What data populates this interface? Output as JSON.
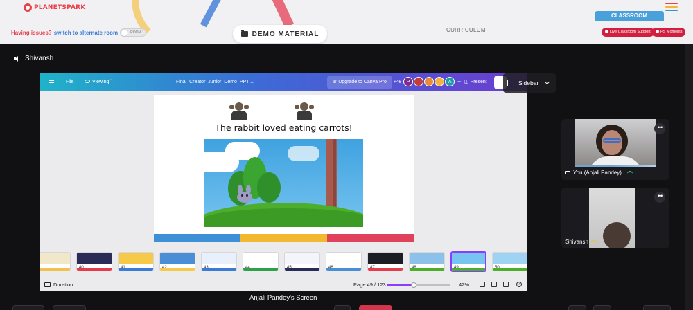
{
  "app": {
    "logo_text": "PLANETSPARK",
    "issues_text": "Having issues?",
    "switch_link": "switch to alternate room",
    "room_toggle_label": "ROOM 1",
    "demo_material_label": "DEMO MATERIAL",
    "curriculum_label": "CURRICULUM",
    "classroom_tab": "CLASSROOM",
    "live_support_label": "Live Classroom Support",
    "ps_moments_label": "PS Moments"
  },
  "meeting": {
    "presenter_name": "Shivansh",
    "screen_label": "Anjali Pandey's Screen",
    "sidebar_label": "Sidebar",
    "participants": [
      {
        "name": "You (Anjali Pandey)",
        "connection_color": "#2ecc71"
      },
      {
        "name": "Shivansh",
        "connection_color": "#f1c40f"
      }
    ]
  },
  "canva": {
    "file_label": "File",
    "viewing_label": "Viewing",
    "doc_title": "Final_Creator_Junior_Demo_PPT ...",
    "upgrade_label": "Upgrade to Canva Pro",
    "collab_count": "+46",
    "collaborators": [
      {
        "initial": "P",
        "color": "#7b2d8e"
      },
      {
        "initial": "",
        "color": "#c43b3b"
      },
      {
        "initial": "",
        "color": "#e88c3a"
      },
      {
        "initial": "",
        "color": "#f3b340"
      },
      {
        "initial": "A",
        "color": "#1f9aa8"
      }
    ],
    "add_label": "+",
    "present_label": "Present",
    "slide_text": "The rabbit loved eating carrots!",
    "thumbnails": [
      {
        "num": "",
        "band": "#f1e7c9",
        "bar": "#f2c14e"
      },
      {
        "num": "40",
        "band": "#2b2b58",
        "bar": "#e43c4c"
      },
      {
        "num": "41",
        "band": "#f7c948",
        "bar": "#3a7bd5"
      },
      {
        "num": "42",
        "band": "#4a8fd6",
        "bar": "#f7c948"
      },
      {
        "num": "43",
        "band": "#e8f0fb",
        "bar": "#3a7bd5"
      },
      {
        "num": "44",
        "band": "#ffffff",
        "bar": "#2ea04a"
      },
      {
        "num": "45",
        "band": "#f3f5fa",
        "bar": "#2b2b58"
      },
      {
        "num": "46",
        "band": "#ffffff",
        "bar": "#4a8fd6"
      },
      {
        "num": "47",
        "band": "#1d1d24",
        "bar": "#e43c4c"
      },
      {
        "num": "48",
        "band": "#8cc2ea",
        "bar": "#4cae2a"
      },
      {
        "num": "49",
        "band": "#76c4ef",
        "bar": "#4cae2a"
      },
      {
        "num": "50",
        "band": "#9fd3f3",
        "bar": "#4cae2a"
      }
    ],
    "thumb_slot": {
      "active_index": 10
    },
    "duration_label": "Duration",
    "page_indicator": "Page 49 / 123",
    "zoom_label": "42%",
    "zoom_level": 0.42,
    "help_label": "?"
  },
  "colors": {
    "brand_red": "#e8404a",
    "classroom_blue": "#4aa0d8",
    "pill_red": "#d01f3f",
    "canva_purple": "#8b3dff",
    "stripe_blue": "#3d8fd6",
    "stripe_yellow": "#f2b930",
    "stripe_red": "#e0425b"
  }
}
